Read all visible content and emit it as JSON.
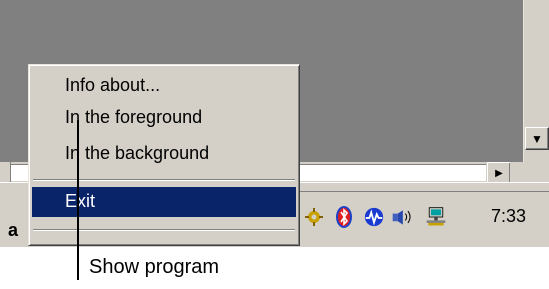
{
  "menu": {
    "items": [
      {
        "label": "Info about..."
      },
      {
        "label": "In the foreground"
      },
      {
        "label": "In the background"
      }
    ],
    "exit_label": "Exit",
    "highlight_color": "#0a246a"
  },
  "taskbar": {
    "task_label": "a",
    "clock": "7:33",
    "tray_icons": [
      "gear-tray-icon",
      "bluetooth-icon",
      "wave-monitor-icon",
      "speaker-icon",
      "network-icon"
    ]
  },
  "annotation": {
    "caption": "Show program"
  },
  "scrollbars": {
    "up_arrow": "▼",
    "right_arrow": "▶"
  }
}
